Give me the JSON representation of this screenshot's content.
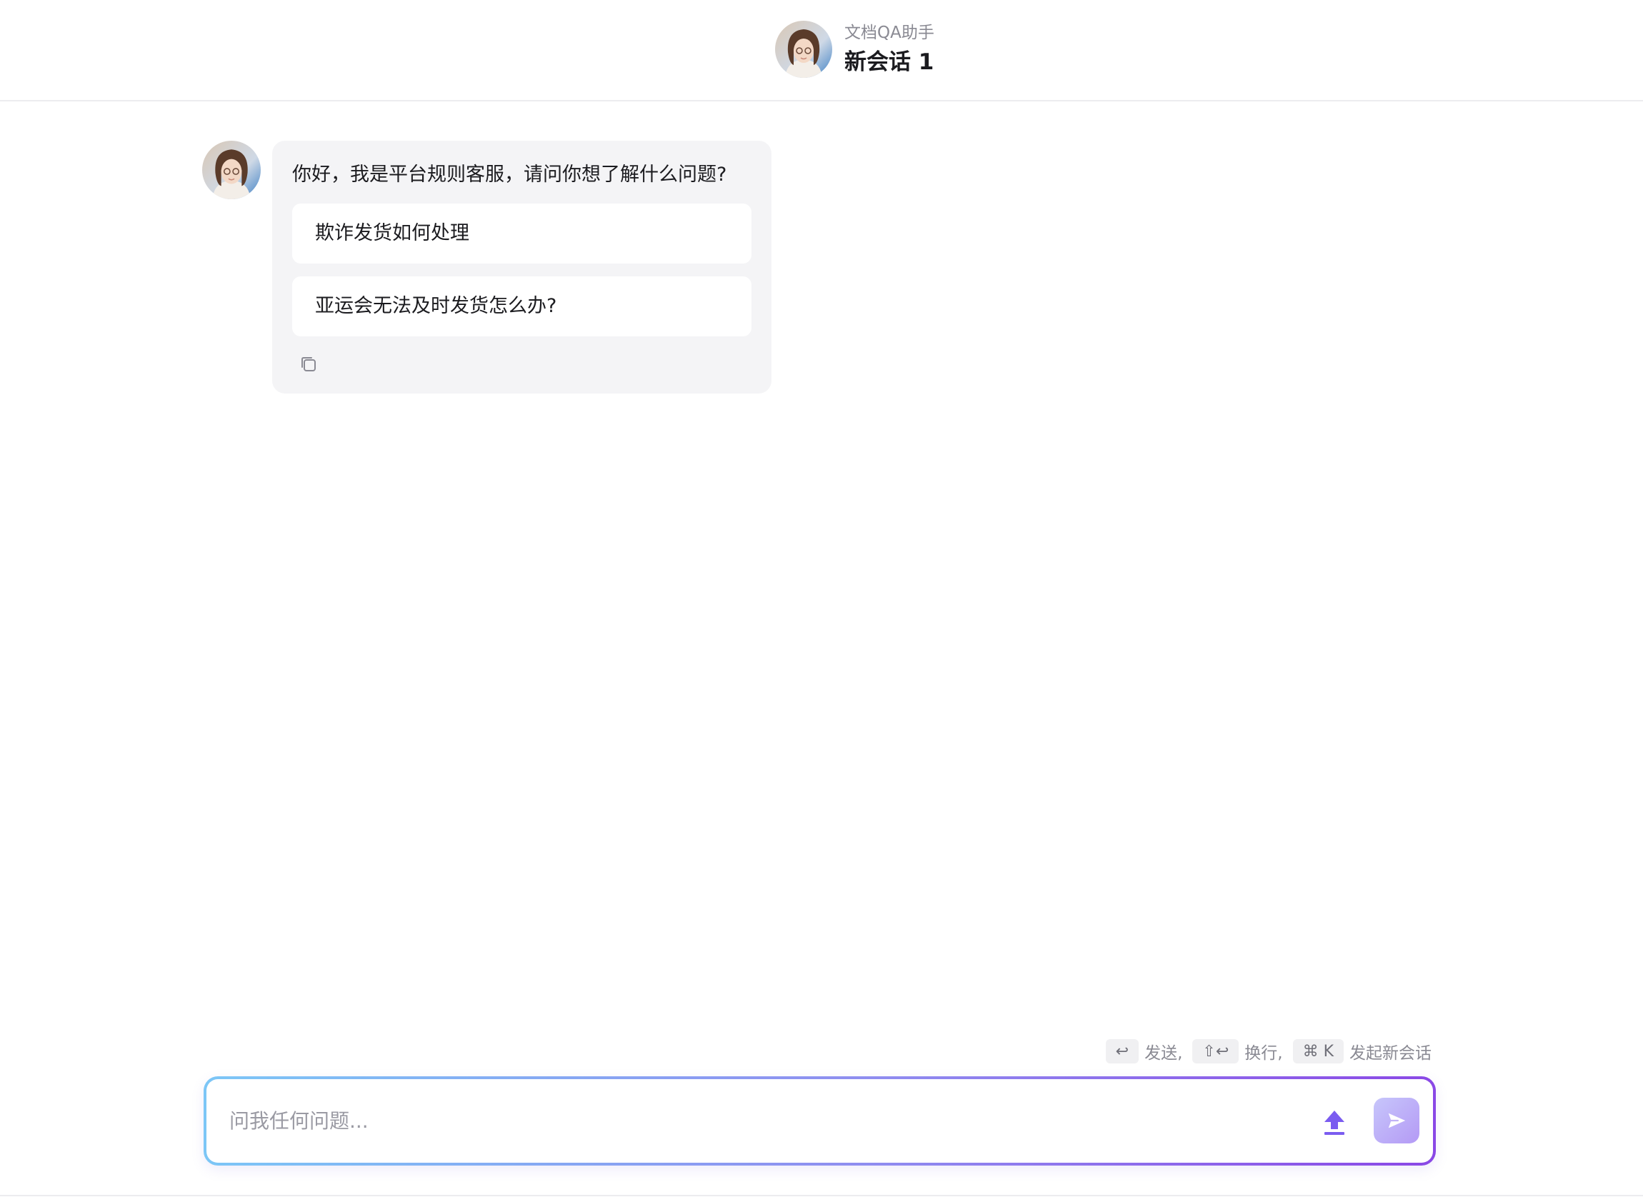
{
  "header": {
    "subtitle": "文档QA助手",
    "title": "新会话 1",
    "avatar_icon": "assistant-avatar"
  },
  "chat": {
    "messages": [
      {
        "role": "assistant",
        "text": "你好，我是平台规则客服，请问你想了解什么问题?",
        "suggestions": [
          "欺诈发货如何处理",
          "亚运会无法及时发货怎么办?"
        ],
        "actions": [
          "copy-icon"
        ]
      }
    ]
  },
  "hints": {
    "send_key": "↩",
    "send_label": "发送,",
    "newline_key": "⇧↩",
    "newline_label": "换行,",
    "newchat_key": "⌘ K",
    "newchat_label": "发起新会话"
  },
  "input": {
    "placeholder": "问我任何问题...",
    "value": "",
    "upload_icon": "upload-icon",
    "send_icon": "send-icon"
  },
  "colors": {
    "accent_start": "#7cc6f6",
    "accent_end": "#8a48e6",
    "upload_icon": "#7b5cf0",
    "send_button": "#b49af5",
    "bubble_bg": "#f4f4f6"
  }
}
